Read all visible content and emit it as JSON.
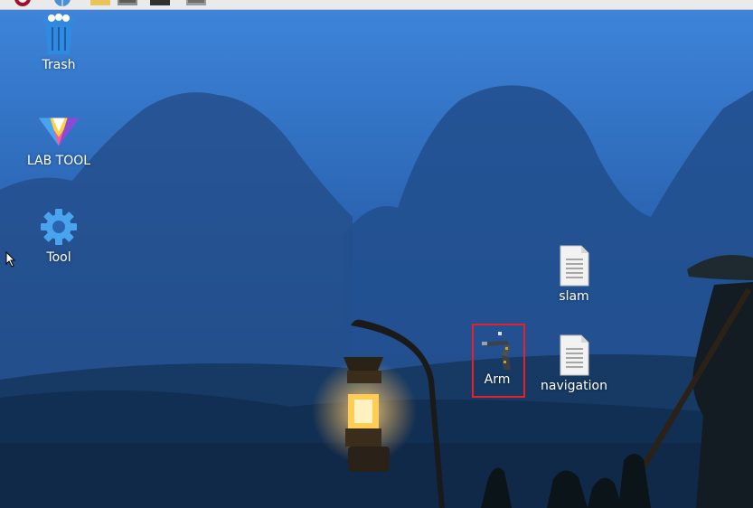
{
  "taskbar": {
    "items": [
      {
        "name": "raspberry-menu-icon"
      },
      {
        "name": "web-browser-icon"
      },
      {
        "name": "file-manager-icon"
      },
      {
        "name": "terminal-icon"
      },
      {
        "name": "terminal-dark-icon"
      },
      {
        "name": "app-window-icon"
      }
    ]
  },
  "desktop": {
    "icons": [
      {
        "id": "trash",
        "label": "Trash",
        "icon": "trash-icon"
      },
      {
        "id": "lab-tool",
        "label": "LAB TOOL",
        "icon": "color-prism-icon"
      },
      {
        "id": "tool",
        "label": "Tool",
        "icon": "gear-icon"
      },
      {
        "id": "slam",
        "label": "slam",
        "icon": "text-file-icon"
      },
      {
        "id": "navigation",
        "label": "navigation",
        "icon": "text-file-icon"
      },
      {
        "id": "arm",
        "label": "Arm",
        "icon": "robot-arm-icon",
        "selected": true
      }
    ]
  },
  "colors": {
    "selection_border": "#e8202a",
    "label_text": "#ffffff",
    "gear_blue": "#4aa3ef",
    "trash_blue": "#2f8ae0"
  }
}
